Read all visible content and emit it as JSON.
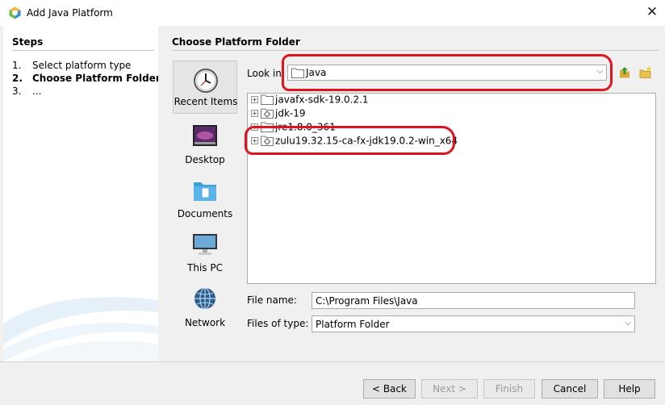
{
  "window": {
    "title": "Add Java Platform",
    "close_glyph": "✕"
  },
  "steps": {
    "title": "Steps",
    "items": [
      {
        "num": "1.",
        "label": "Select platform type"
      },
      {
        "num": "2.",
        "label": "Choose Platform Folder"
      },
      {
        "num": "3.",
        "label": "..."
      }
    ]
  },
  "panel": {
    "title": "Choose Platform Folder"
  },
  "places": [
    {
      "label": "Recent Items",
      "icon": "clock-icon"
    },
    {
      "label": "Desktop",
      "icon": "desktop-icon"
    },
    {
      "label": "Documents",
      "icon": "folder-icon"
    },
    {
      "label": "This PC",
      "icon": "monitor-icon"
    },
    {
      "label": "Network",
      "icon": "globe-icon"
    }
  ],
  "look_in": {
    "label": "Look in:",
    "value": "Java"
  },
  "tree": [
    {
      "label": "javafx-sdk-19.0.2.1",
      "icon": "folder-icon"
    },
    {
      "label": "jdk-19",
      "icon": "platform-folder-icon"
    },
    {
      "label": "jre1.8.0_361",
      "icon": "folder-icon"
    },
    {
      "label": "zulu19.32.15-ca-fx-jdk19.0.2-win_x64",
      "icon": "platform-folder-icon"
    }
  ],
  "file_name": {
    "label": "File name:",
    "value": "C:\\Program Files\\Java"
  },
  "files_of_type": {
    "label": "Files of type:",
    "value": "Platform Folder"
  },
  "buttons": {
    "back": "< Back",
    "next": "Next >",
    "finish": "Finish",
    "cancel": "Cancel",
    "help": "Help"
  }
}
